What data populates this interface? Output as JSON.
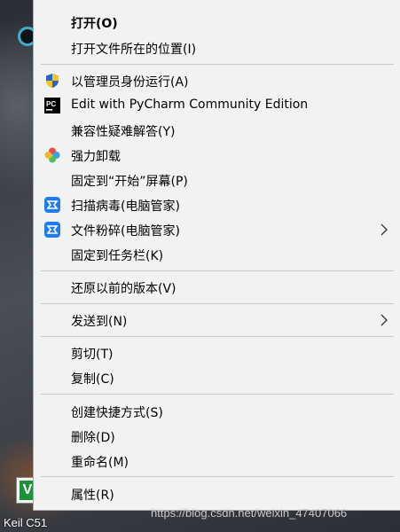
{
  "desktop": {
    "shortcut_label": "Keil C51",
    "watermark": "https://blog.csdn.net/weixin_47407066"
  },
  "menu": {
    "items": [
      {
        "label": "打开(O)",
        "icon": "",
        "submenu": false
      },
      {
        "label": "打开文件所在的位置(I)",
        "icon": "",
        "submenu": false
      },
      {
        "label": "以管理员身份运行(A)",
        "icon": "uac-shield-icon",
        "submenu": false
      },
      {
        "label": "Edit with PyCharm Community Edition",
        "icon": "pycharm-icon",
        "submenu": false
      },
      {
        "label": "兼容性疑难解答(Y)",
        "icon": "",
        "submenu": false
      },
      {
        "label": "强力卸载",
        "icon": "uninstall-icon",
        "submenu": false
      },
      {
        "label": "固定到“开始”屏幕(P)",
        "icon": "",
        "submenu": false
      },
      {
        "label": "扫描病毒(电脑管家)",
        "icon": "tencent-manager-icon",
        "submenu": false
      },
      {
        "label": "文件粉碎(电脑管家)",
        "icon": "tencent-manager-icon",
        "submenu": true
      },
      {
        "label": "固定到任务栏(K)",
        "icon": "",
        "submenu": false
      },
      {
        "label": "还原以前的版本(V)",
        "icon": "",
        "submenu": false
      },
      {
        "label": "发送到(N)",
        "icon": "",
        "submenu": true
      },
      {
        "label": "剪切(T)",
        "icon": "",
        "submenu": false
      },
      {
        "label": "复制(C)",
        "icon": "",
        "submenu": false
      },
      {
        "label": "创建快捷方式(S)",
        "icon": "",
        "submenu": false
      },
      {
        "label": "删除(D)",
        "icon": "",
        "submenu": false
      },
      {
        "label": "重命名(M)",
        "icon": "",
        "submenu": false
      },
      {
        "label": "属性(R)",
        "icon": "",
        "submenu": false
      }
    ]
  }
}
